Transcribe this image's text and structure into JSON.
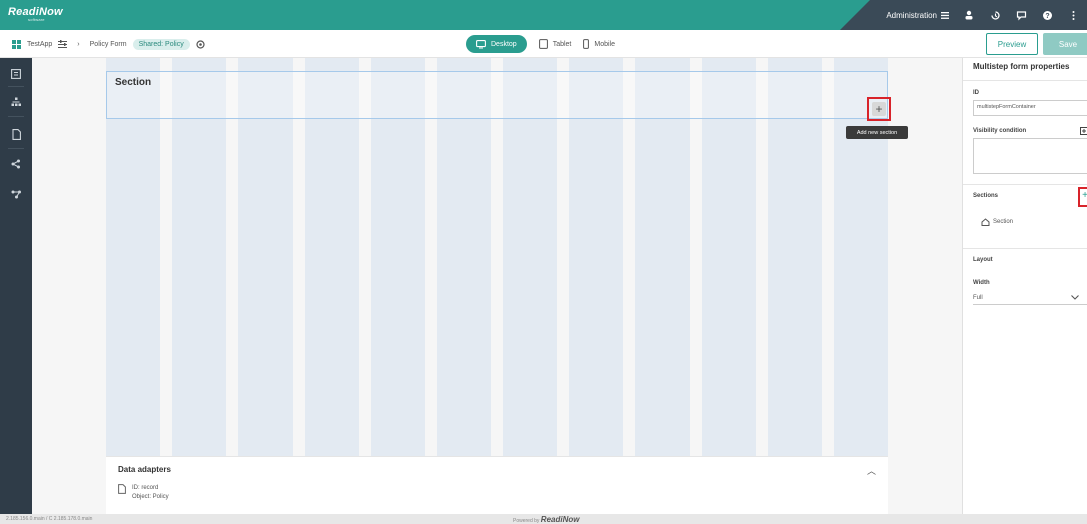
{
  "brand": {
    "name": "ReadiNow",
    "sub": "software"
  },
  "topbar": {
    "admin_label": "Administration"
  },
  "breadcrumb": {
    "app": "TestApp",
    "form": "Policy Form",
    "badge": "Shared: Policy"
  },
  "devices": {
    "desktop": "Desktop",
    "tablet": "Tablet",
    "mobile": "Mobile"
  },
  "actions": {
    "preview": "Preview",
    "save": "Save"
  },
  "canvas": {
    "section_title": "Section",
    "add_section_tooltip": "Add new section",
    "add_symbol": "+"
  },
  "data_adapters": {
    "title": "Data adapters",
    "item": {
      "id": "ID: record",
      "object": "Object: Policy"
    }
  },
  "right_panel": {
    "title": "Multistep form properties",
    "id_label": "ID",
    "id_value": "multistepFormContainer",
    "visibility_label": "Visibility condition",
    "sections_label": "Sections",
    "sections_add": "+",
    "sections_items": [
      "Section"
    ],
    "layout_label": "Layout",
    "width_label": "Width",
    "width_value": "Full"
  },
  "footer": {
    "version": "2.185.156.0.main / C 2.185.178.0.main",
    "powered_by": "Powered by",
    "powered_brand": "ReadiNow"
  },
  "colors": {
    "accent": "#2a9d8f",
    "dark": "#2f3c48",
    "highlight": "#d8232a"
  }
}
